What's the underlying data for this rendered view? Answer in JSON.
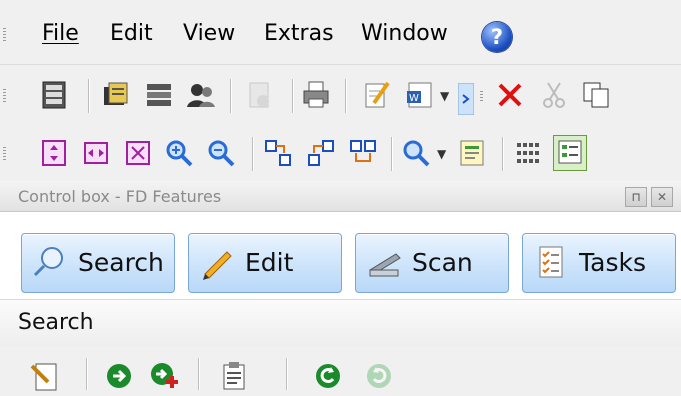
{
  "menubar": {
    "items": [
      {
        "label": "File"
      },
      {
        "label": "Edit"
      },
      {
        "label": "View"
      },
      {
        "label": "Extras"
      },
      {
        "label": "Window"
      }
    ],
    "help_glyph": "?"
  },
  "panel": {
    "title": "Control box - FD Features",
    "buttons": [
      {
        "label": "Search",
        "icon": "search-icon"
      },
      {
        "label": "Edit",
        "icon": "pencil-icon"
      },
      {
        "label": "Scan",
        "icon": "scanner-icon"
      },
      {
        "label": "Tasks",
        "icon": "tasks-icon"
      }
    ],
    "section_label": "Search"
  },
  "colors": {
    "delete_red": "#e01010",
    "accent_blue": "#1b4fbf",
    "nav_green": "#1a8a2a",
    "magnifier": "#2a6cd6"
  }
}
